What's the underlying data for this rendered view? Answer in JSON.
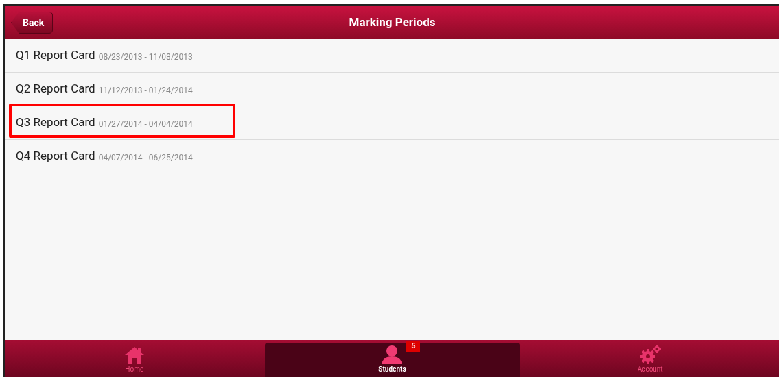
{
  "header": {
    "back_button": "Back",
    "title": "Marking Periods"
  },
  "marking_periods": [
    {
      "name": "Q1 Report Card",
      "dates": "08/23/2013 - 11/08/2013",
      "highlighted": false
    },
    {
      "name": "Q2 Report Card",
      "dates": "11/12/2013 - 01/24/2014",
      "highlighted": false
    },
    {
      "name": "Q3 Report Card",
      "dates": "01/27/2014 - 04/04/2014",
      "highlighted": true
    },
    {
      "name": "Q4 Report Card",
      "dates": "04/07/2014 - 06/25/2014",
      "highlighted": false
    }
  ],
  "tab_bar": [
    {
      "kind": "home",
      "label": "Home",
      "selected": false
    },
    {
      "kind": "students",
      "label": "Students",
      "selected": true,
      "badge": "5"
    },
    {
      "kind": "account",
      "label": "Account",
      "selected": false
    }
  ]
}
